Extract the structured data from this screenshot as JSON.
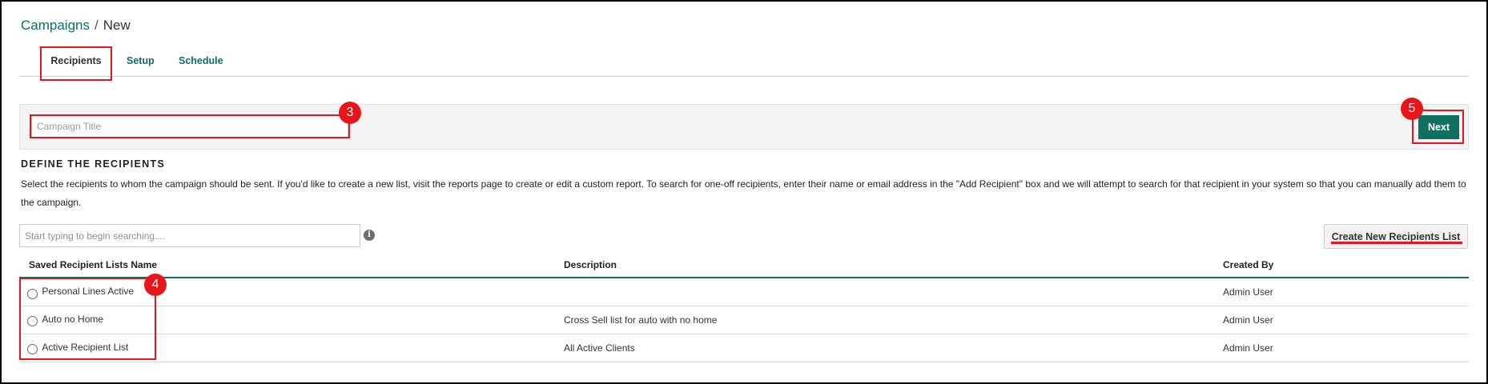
{
  "breadcrumb": {
    "parent": "Campaigns",
    "separator": "/",
    "current": "New"
  },
  "tabs": [
    {
      "label": "Recipients",
      "active": true
    },
    {
      "label": "Setup",
      "active": false
    },
    {
      "label": "Schedule",
      "active": false
    }
  ],
  "title_bar": {
    "campaign_title_placeholder": "Campaign Title",
    "campaign_title_value": "",
    "next_label": "Next"
  },
  "recipients": {
    "heading": "DEFINE THE RECIPIENTS",
    "description": "Select the recipients to whom the campaign should be sent. If you'd like to create a new list, visit the reports page to create or edit a custom report. To search for one-off recipients, enter their name or email address in the \"Add Recipient\" box and we will attempt to search for that recipient in your system so that you can manually add them to the campaign.",
    "search_placeholder": "Start typing to begin searching....",
    "info_icon": "info-icon",
    "create_list_label": "Create New Recipients List"
  },
  "table": {
    "columns": [
      "Saved Recipient Lists Name",
      "Description",
      "Created By"
    ],
    "rows": [
      {
        "name": "Personal Lines Active",
        "description": "",
        "created_by": "Admin User",
        "selected": false
      },
      {
        "name": "Auto no Home",
        "description": "Cross Sell list for auto with no home",
        "created_by": "Admin User",
        "selected": false
      },
      {
        "name": "Active Recipient List",
        "description": "All Active Clients",
        "created_by": "Admin User",
        "selected": false
      }
    ]
  },
  "annotations": {
    "title_input_marker": "3",
    "list_radio_marker": "4",
    "next_button_marker": "5",
    "color": "#e8151b"
  },
  "colors": {
    "accent": "#0d7060",
    "annotation": "#e8151b"
  }
}
